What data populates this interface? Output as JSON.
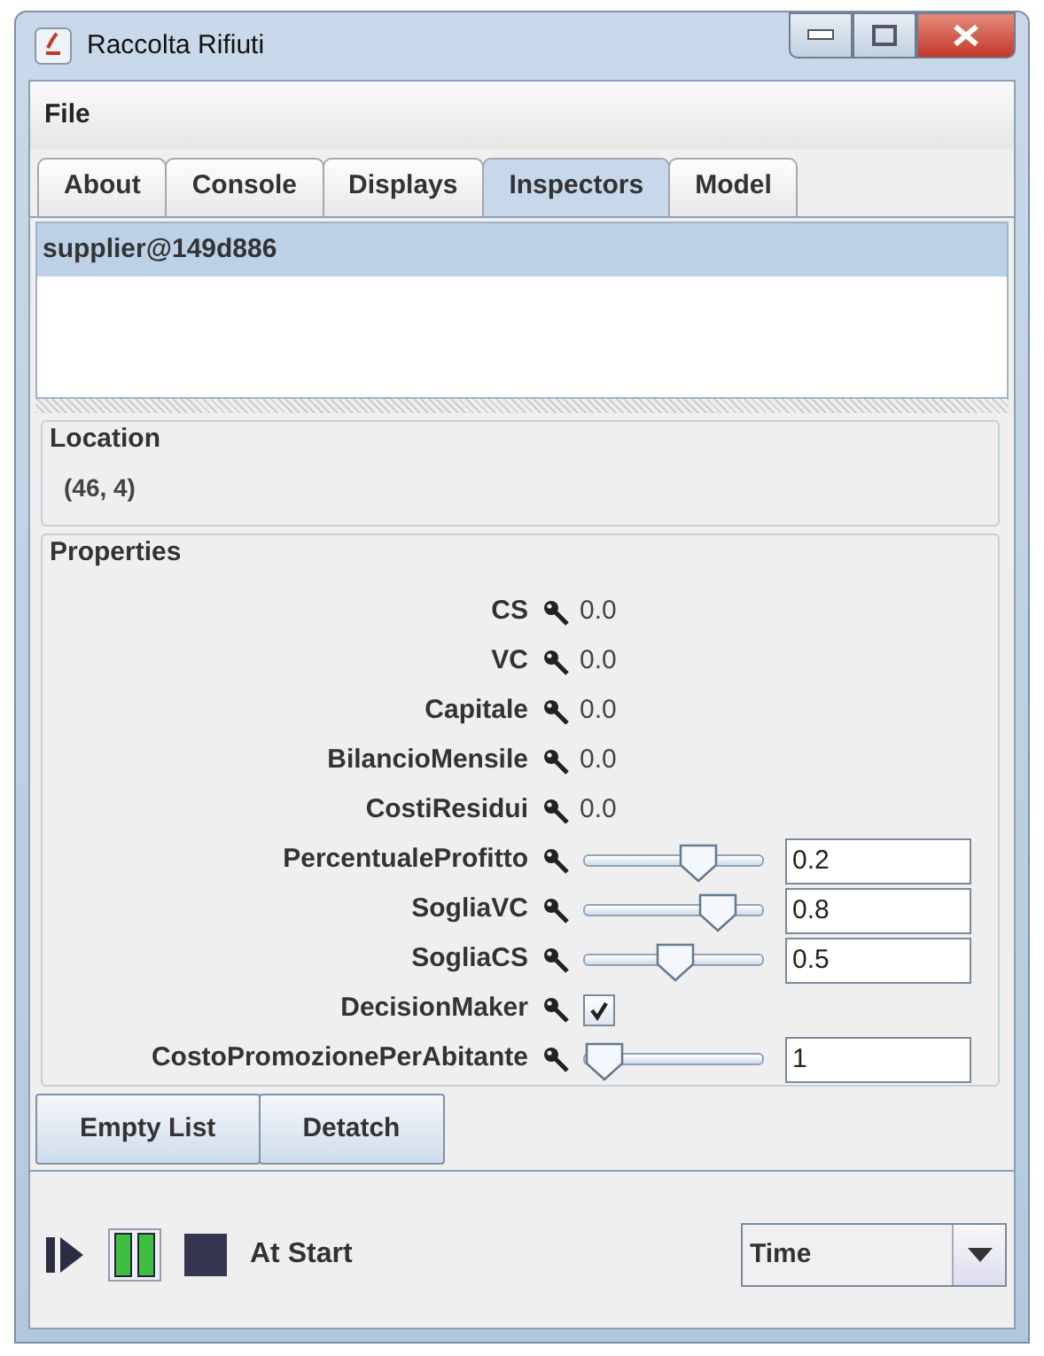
{
  "window": {
    "title": "Raccolta Rifiuti"
  },
  "menu": [
    "File"
  ],
  "tabs": [
    {
      "label": "About",
      "selected": false
    },
    {
      "label": "Console",
      "selected": false
    },
    {
      "label": "Displays",
      "selected": false
    },
    {
      "label": "Inspectors",
      "selected": true
    },
    {
      "label": "Model",
      "selected": false
    }
  ],
  "inspector_list": [
    {
      "label": "supplier@149d886",
      "selected": true
    }
  ],
  "location": {
    "title": "Location",
    "value": "(46, 4)"
  },
  "properties": {
    "title": "Properties",
    "items": [
      {
        "kind": "readonly",
        "name": "CS",
        "value": "0.0"
      },
      {
        "kind": "readonly",
        "name": "VC",
        "value": "0.0"
      },
      {
        "kind": "readonly",
        "name": "Capitale",
        "value": "0.0"
      },
      {
        "kind": "readonly",
        "name": "BilancioMensile",
        "value": "0.0"
      },
      {
        "kind": "readonly",
        "name": "CostiResidui",
        "value": "0.0"
      },
      {
        "kind": "slider",
        "name": "PercentualeProfitto",
        "level": 0.68,
        "value": "0.2"
      },
      {
        "kind": "slider",
        "name": "SogliaVC",
        "level": 0.82,
        "value": "0.8"
      },
      {
        "kind": "slider",
        "name": "SogliaCS",
        "level": 0.51,
        "value": "0.5"
      },
      {
        "kind": "checkbox",
        "name": "DecisionMaker",
        "checked": true
      },
      {
        "kind": "slider",
        "name": "CostoPromozionePerAbitante",
        "level": 0,
        "value": "1"
      }
    ]
  },
  "buttons": [
    "Empty List",
    "Detatch"
  ],
  "controls": {
    "pause_on": true,
    "status": "At Start",
    "time_mode": "Time"
  }
}
